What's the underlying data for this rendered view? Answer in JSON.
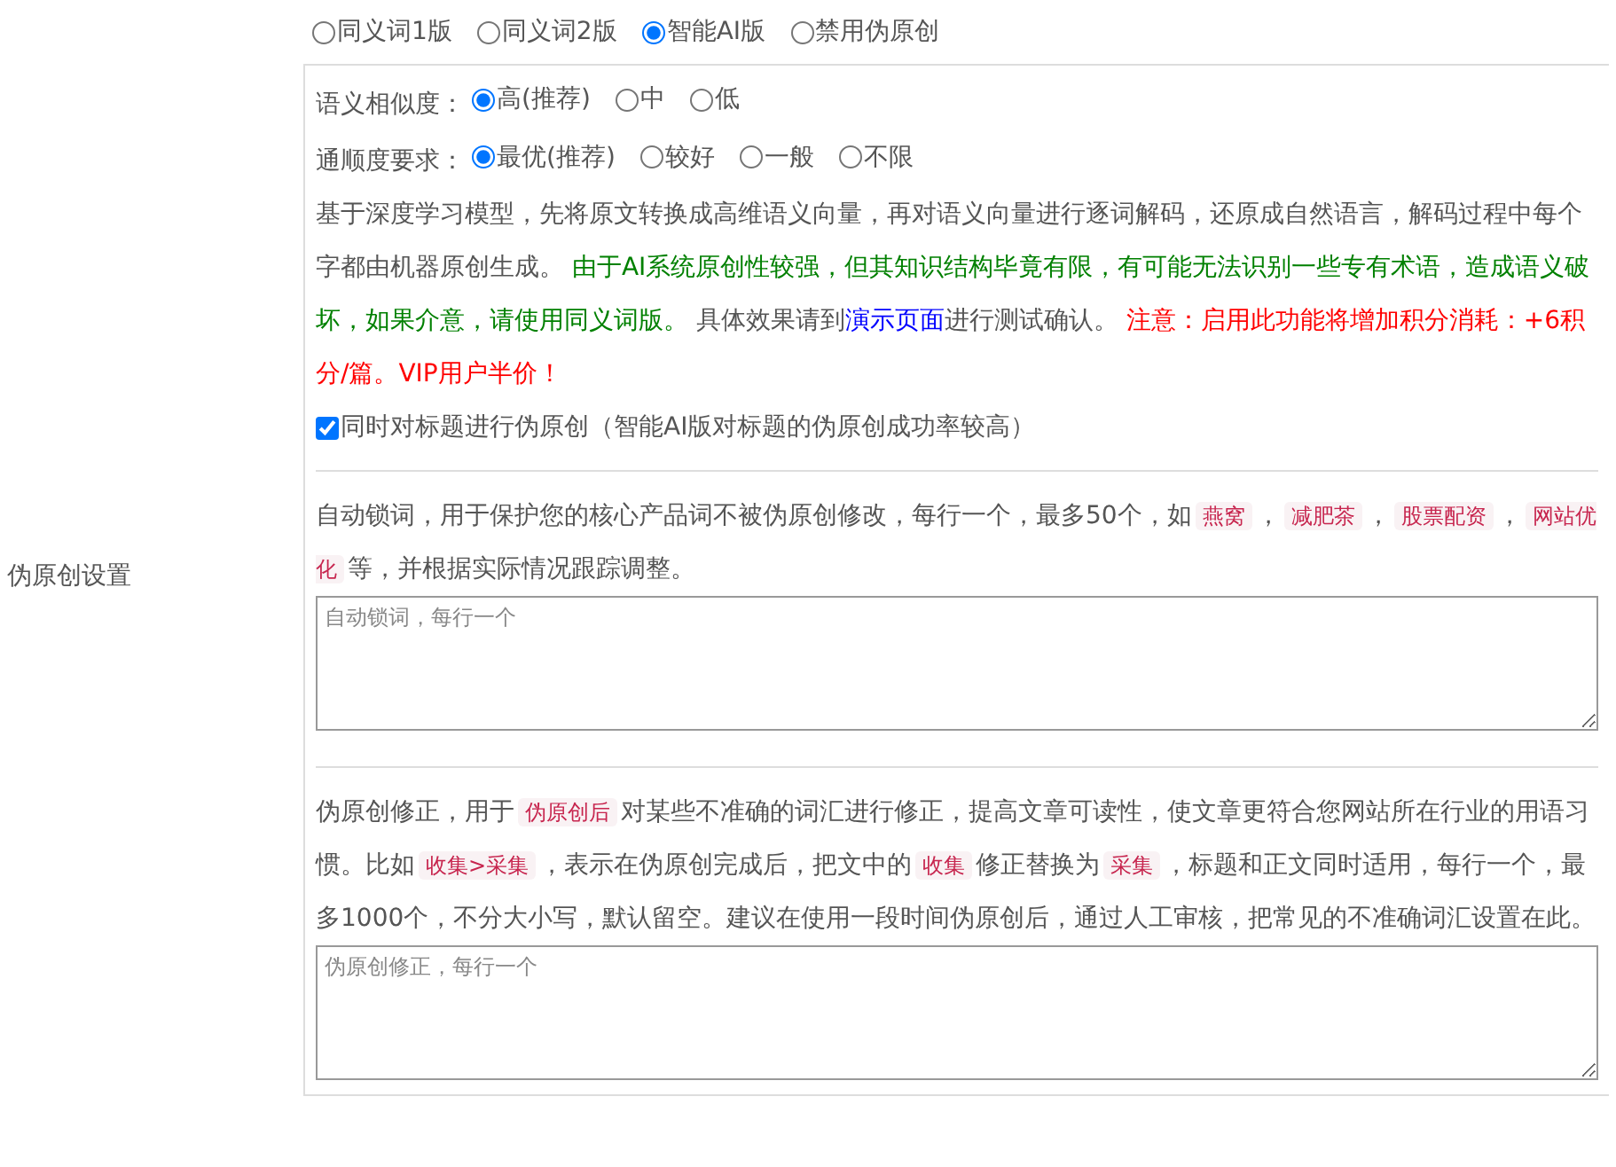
{
  "section_label": "伪原创设置",
  "versions": [
    {
      "label": "同义词1版",
      "selected": false
    },
    {
      "label": "同义词2版",
      "selected": false
    },
    {
      "label": "智能AI版",
      "selected": true
    },
    {
      "label": "禁用伪原创",
      "selected": false
    }
  ],
  "similarity": {
    "label": "语义相似度：",
    "options": [
      {
        "label": "高(推荐)",
        "selected": true
      },
      {
        "label": "中",
        "selected": false
      },
      {
        "label": "低",
        "selected": false
      }
    ]
  },
  "fluency": {
    "label": "通顺度要求：",
    "options": [
      {
        "label": "最优(推荐)",
        "selected": true
      },
      {
        "label": "较好",
        "selected": false
      },
      {
        "label": "一般",
        "selected": false
      },
      {
        "label": "不限",
        "selected": false
      }
    ]
  },
  "description": [
    {
      "kind": "plain",
      "text": "基于深度学习模型，先将原文转换成高维语义向量，再对语义向量进行逐词解码，还原成自然语言，解码过程中每个字都由机器原创生成。 "
    },
    {
      "kind": "green",
      "text": "由于AI系统原创性较强，但其知识结构毕竟有限，有可能无法识别一些专有术语，造成语义破坏，如果介意，请使用同义词版。"
    },
    {
      "kind": "plain",
      "text": " 具体效果请到"
    },
    {
      "kind": "link",
      "text": "演示页面"
    },
    {
      "kind": "plain",
      "text": "进行测试确认。 "
    },
    {
      "kind": "red",
      "text": "注意：启用此功能将增加积分消耗：+6积分/篇。VIP用户半价！"
    }
  ],
  "title_option": {
    "label": "同时对标题进行伪原创（智能AI版对标题的伪原创成功率较高）",
    "checked": true
  },
  "lock_words": {
    "intro": [
      {
        "kind": "plain",
        "text": "自动锁词，用于保护您的核心产品词不被伪原创修改，每行一个，最多50个，如"
      },
      {
        "kind": "code",
        "text": "燕窝"
      },
      {
        "kind": "plain",
        "text": "，"
      },
      {
        "kind": "code",
        "text": "减肥茶"
      },
      {
        "kind": "plain",
        "text": "，"
      },
      {
        "kind": "code",
        "text": "股票配资"
      },
      {
        "kind": "plain",
        "text": "，"
      },
      {
        "kind": "code",
        "text": "网站优化"
      },
      {
        "kind": "plain",
        "text": "等，并根据实际情况跟踪调整。"
      }
    ],
    "placeholder": "自动锁词，每行一个"
  },
  "correction": {
    "intro": [
      {
        "kind": "plain",
        "text": "伪原创修正，用于"
      },
      {
        "kind": "code",
        "text": "伪原创后"
      },
      {
        "kind": "plain",
        "text": "对某些不准确的词汇进行修正，提高文章可读性，使文章更符合您网站所在行业的用语习惯。比如"
      },
      {
        "kind": "code",
        "text": "收集>采集"
      },
      {
        "kind": "plain",
        "text": "，表示在伪原创完成后，把文中的"
      },
      {
        "kind": "code",
        "text": "收集"
      },
      {
        "kind": "plain",
        "text": "修正替换为"
      },
      {
        "kind": "code",
        "text": "采集"
      },
      {
        "kind": "plain",
        "text": "，标题和正文同时适用，每行一个，最多1000个，不分大小写，默认留空。建议在使用一段时间伪原创后，通过人工审核，把常见的不准确词汇设置在此。"
      }
    ],
    "placeholder": "伪原创修正，每行一个"
  }
}
